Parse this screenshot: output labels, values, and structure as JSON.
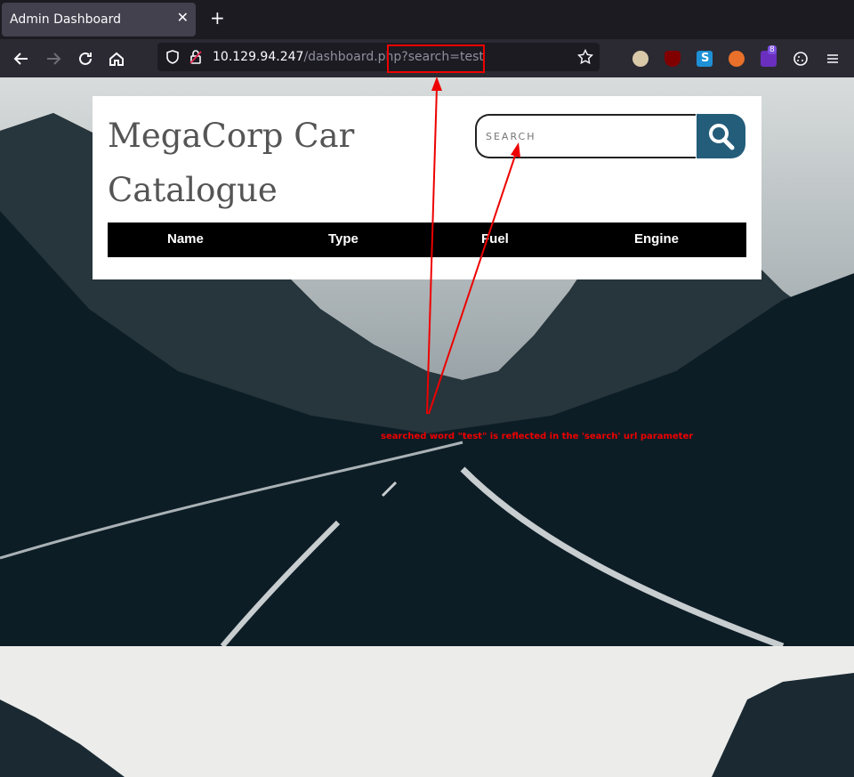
{
  "browser": {
    "tab_title": "Admin Dashboard",
    "url_host": "10.129.94.247",
    "url_path": "/dashboard.php?search=test",
    "extension_badge": "8"
  },
  "page": {
    "title": "MegaCorp Car Catalogue",
    "search_placeholder": "SEARCH",
    "table_headers": [
      "Name",
      "Type",
      "Fuel",
      "Engine"
    ]
  },
  "annotation": {
    "text": "searched word \"test\" is reflected in the 'search' url parameter",
    "color": "#e00000"
  }
}
